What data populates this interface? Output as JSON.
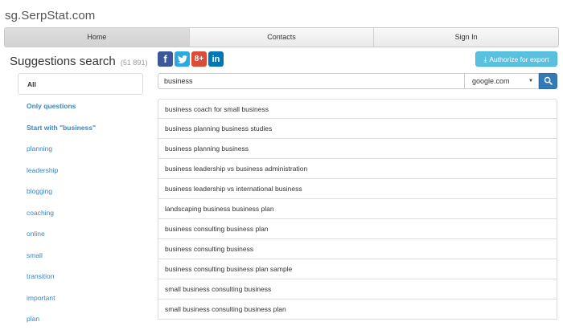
{
  "site": {
    "title": "sg.SerpStat.com"
  },
  "nav": {
    "items": [
      "Home",
      "Contacts",
      "Sign In"
    ]
  },
  "heading": {
    "title": "Suggestions search",
    "count": "(51 891)"
  },
  "social": {
    "facebook": "f",
    "twitter": "t",
    "google_plus": "8+",
    "linkedin": "in"
  },
  "export_button": {
    "label": "Authorize for export",
    "icon": "download-icon"
  },
  "search": {
    "value": "business",
    "engine": "google.com",
    "button_icon": "search-icon"
  },
  "sidebar": {
    "items": [
      "All",
      "Only questions",
      "Start with \"business\"",
      "planning",
      "leadership",
      "blogging",
      "coaching",
      "online",
      "small",
      "transition",
      "important",
      "plan"
    ]
  },
  "results": [
    "business coach for small business",
    "business planning business studies",
    "business planning business",
    "business leadership vs business administration",
    "business leadership vs international business",
    "landscaping business business plan",
    "business consulting business plan",
    "business consulting business",
    "business consulting business plan sample",
    "small business consulting business",
    "small business consulting business plan"
  ],
  "colors": {
    "link": "#3c84c3",
    "export_button": "#5bc0de",
    "search_button": "#337ab7"
  }
}
